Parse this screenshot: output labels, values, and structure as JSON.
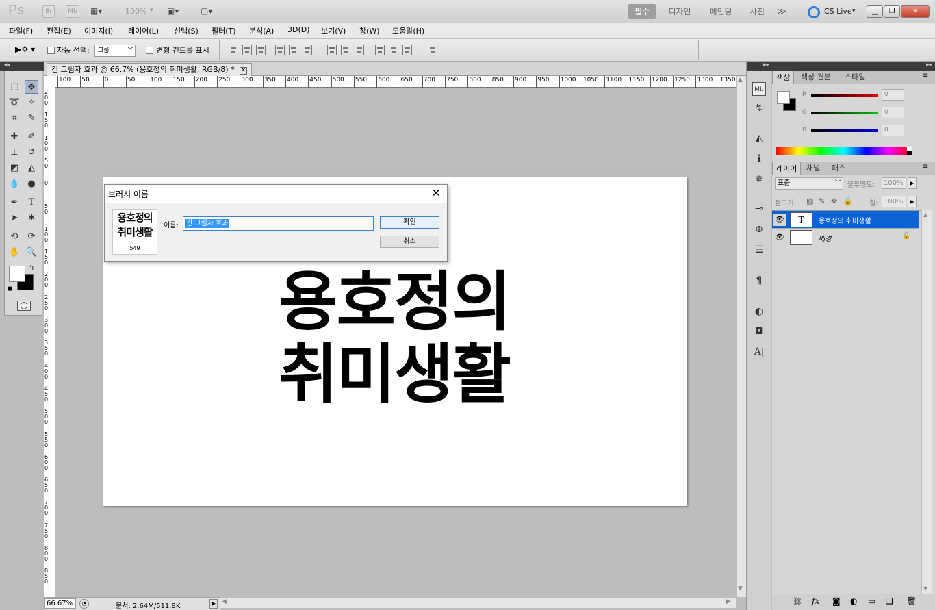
{
  "app": {
    "logo": "Ps",
    "bridge": "Br",
    "minibridge": "Mb",
    "zoom_select": "100%",
    "workspaces": [
      "필수",
      "디자인",
      "페인팅",
      "사진"
    ],
    "more": "≫",
    "cslive": "CS Live"
  },
  "window_controls": {
    "minimize": "▁",
    "restore": "❐",
    "close": "✕"
  },
  "menu": [
    "파일(F)",
    "편집(E)",
    "이미지(I)",
    "레이어(L)",
    "선택(S)",
    "필터(T)",
    "분석(A)",
    "3D(D)",
    "보기(V)",
    "창(W)",
    "도움말(H)"
  ],
  "options": {
    "auto_select_label": "자동 선택:",
    "auto_select_value": "그룹",
    "transform_label": "변형 컨트롤 표시"
  },
  "document": {
    "tab_title": "긴 그림자 효과 @ 66.7% (용호정의 취미생활, RGB/8) *",
    "canvas_text_line1": "용호정의",
    "canvas_text_line2": "취미생활"
  },
  "rulers": {
    "h_labels": [
      "100",
      "50",
      "0",
      "50",
      "100",
      "150",
      "200",
      "250",
      "300",
      "350",
      "400",
      "450",
      "500",
      "550",
      "600",
      "650",
      "700",
      "750",
      "800",
      "850",
      "900",
      "950",
      "1000",
      "1050",
      "1100",
      "1150",
      "1200",
      "1250",
      "1300",
      "1350"
    ],
    "v_labels": [
      "200",
      "150",
      "100",
      "50",
      "0",
      "50",
      "100",
      "150",
      "200",
      "250",
      "300",
      "350",
      "400",
      "450",
      "500",
      "550",
      "600",
      "650",
      "700",
      "750",
      "800",
      "850"
    ]
  },
  "status": {
    "zoom": "66.67%",
    "doc_info": "문서: 2.64M/511.8K"
  },
  "dialog": {
    "title": "브러시 이름",
    "preview_line1": "용호정의",
    "preview_line2": "취미생활",
    "preview_size": "549",
    "name_label": "이름:",
    "name_value": "긴 그림자 효과",
    "ok_label": "확인",
    "cancel_label": "취소"
  },
  "color_panel": {
    "tabs": [
      "색상",
      "색상 견본",
      "스타일"
    ],
    "channels": [
      {
        "label": "R",
        "value": "0",
        "color": "#e00000"
      },
      {
        "label": "G",
        "value": "0",
        "color": "#00c000"
      },
      {
        "label": "B",
        "value": "0",
        "color": "#0000e0"
      }
    ]
  },
  "layers_panel": {
    "tabs": [
      "레이어",
      "채널",
      "패스"
    ],
    "blend_mode": "표준",
    "opacity_label": "불투명도:",
    "opacity_value": "100%",
    "lock_label": "잠그기:",
    "fill_label": "칠:",
    "fill_value": "100%",
    "layers": [
      {
        "name": "용호정의 취미생활",
        "thumb": "T",
        "selected": true
      },
      {
        "name": "배경",
        "thumb": "",
        "selected": false
      }
    ]
  },
  "colors": {
    "accent": "#0a64d6",
    "selection_bg": "#3399ff"
  }
}
